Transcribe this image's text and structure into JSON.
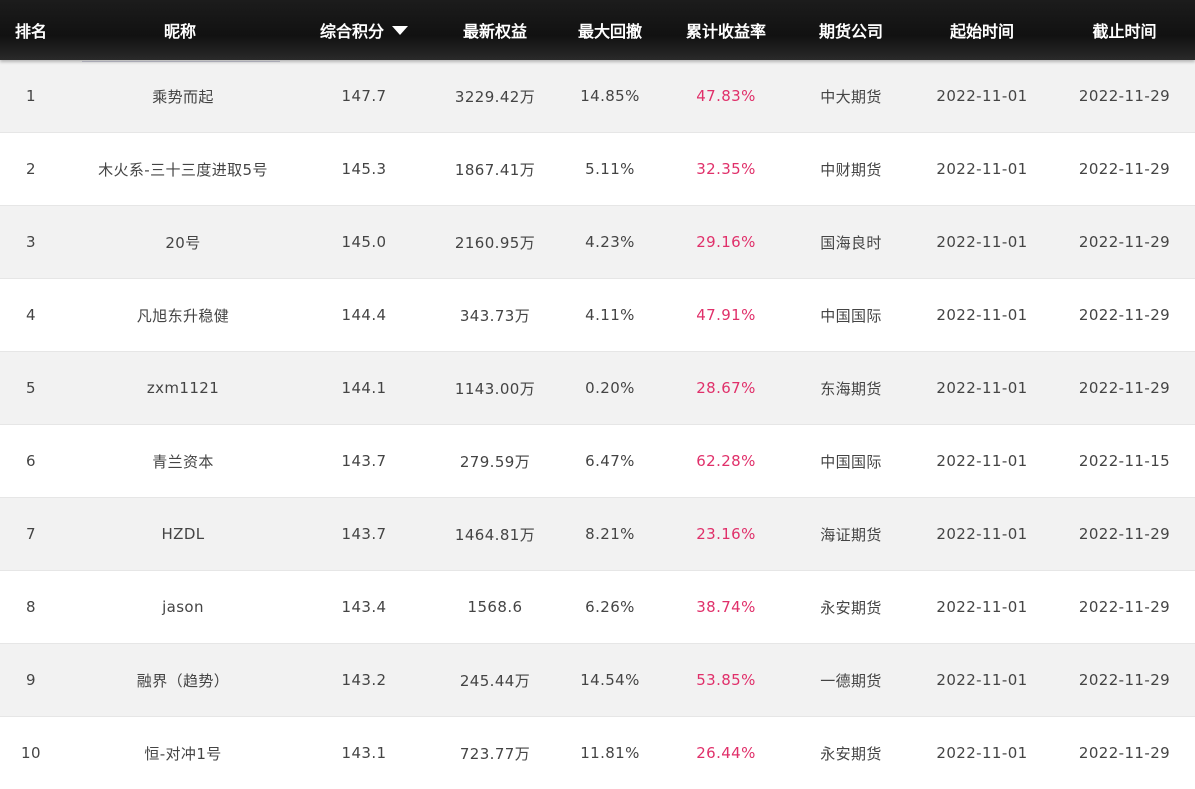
{
  "columns": {
    "rank": "排名",
    "nickname": "昵称",
    "score": "综合积分",
    "equity": "最新权益",
    "drawdown": "最大回撤",
    "return": "累计收益率",
    "broker": "期货公司",
    "start": "起始时间",
    "end": "截止时间"
  },
  "sort": {
    "column": "score",
    "direction": "desc",
    "icon": "sort-down-icon"
  },
  "colors": {
    "header_bg": "#111111",
    "return_text": "#e0306a",
    "row_alt": "#f2f2f2"
  },
  "rows": [
    {
      "rank": "1",
      "nickname": "乘势而起",
      "score": "147.7",
      "equity": "3229.42万",
      "drawdown": "14.85%",
      "return": "47.83%",
      "broker": "中大期货",
      "start": "2022-11-01",
      "end": "2022-11-29"
    },
    {
      "rank": "2",
      "nickname": "木火系-三十三度进取5号",
      "score": "145.3",
      "equity": "1867.41万",
      "drawdown": "5.11%",
      "return": "32.35%",
      "broker": "中财期货",
      "start": "2022-11-01",
      "end": "2022-11-29"
    },
    {
      "rank": "3",
      "nickname": "20号",
      "score": "145.0",
      "equity": "2160.95万",
      "drawdown": "4.23%",
      "return": "29.16%",
      "broker": "国海良时",
      "start": "2022-11-01",
      "end": "2022-11-29"
    },
    {
      "rank": "4",
      "nickname": "凡旭东升稳健",
      "score": "144.4",
      "equity": "343.73万",
      "drawdown": "4.11%",
      "return": "47.91%",
      "broker": "中国国际",
      "start": "2022-11-01",
      "end": "2022-11-29"
    },
    {
      "rank": "5",
      "nickname": "zxm1121",
      "score": "144.1",
      "equity": "1143.00万",
      "drawdown": "0.20%",
      "return": "28.67%",
      "broker": "东海期货",
      "start": "2022-11-01",
      "end": "2022-11-29"
    },
    {
      "rank": "6",
      "nickname": "青兰资本",
      "score": "143.7",
      "equity": "279.59万",
      "drawdown": "6.47%",
      "return": "62.28%",
      "broker": "中国国际",
      "start": "2022-11-01",
      "end": "2022-11-15"
    },
    {
      "rank": "7",
      "nickname": "HZDL",
      "score": "143.7",
      "equity": "1464.81万",
      "drawdown": "8.21%",
      "return": "23.16%",
      "broker": "海证期货",
      "start": "2022-11-01",
      "end": "2022-11-29"
    },
    {
      "rank": "8",
      "nickname": "jason",
      "score": "143.4",
      "equity": "1568.6",
      "drawdown": "6.26%",
      "return": "38.74%",
      "broker": "永安期货",
      "start": "2022-11-01",
      "end": "2022-11-29"
    },
    {
      "rank": "9",
      "nickname": "融界（趋势）",
      "score": "143.2",
      "equity": "245.44万",
      "drawdown": "14.54%",
      "return": "53.85%",
      "broker": "一德期货",
      "start": "2022-11-01",
      "end": "2022-11-29"
    },
    {
      "rank": "10",
      "nickname": "恒-对冲1号",
      "score": "143.1",
      "equity": "723.77万",
      "drawdown": "11.81%",
      "return": "26.44%",
      "broker": "永安期货",
      "start": "2022-11-01",
      "end": "2022-11-29"
    }
  ]
}
